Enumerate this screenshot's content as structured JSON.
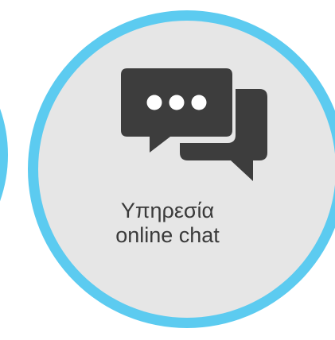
{
  "tile": {
    "label_line1": "Υπηρεσία",
    "label_line2": "online chat",
    "icon": "chat-bubbles-icon",
    "colors": {
      "ring": "#5ccbf0",
      "fill": "#e6e6e6",
      "icon": "#3d3d3d",
      "text": "#3a3a3a"
    }
  }
}
